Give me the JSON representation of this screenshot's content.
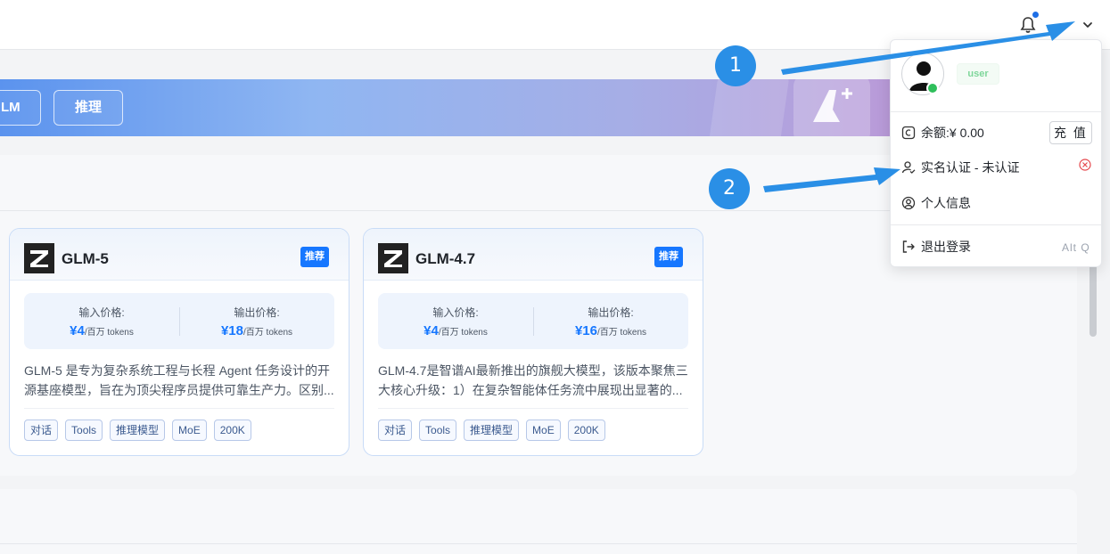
{
  "topbar": {
    "icons": [
      "bell-icon",
      "chevron-down-icon"
    ]
  },
  "banner": {
    "buttons": [
      "LM",
      "推理"
    ]
  },
  "models": [
    {
      "name": "GLM-5",
      "badge": "推荐",
      "input_label": "输入价格:",
      "input_price": "¥4",
      "output_label": "输出价格:",
      "output_price": "¥18",
      "unit": "/百万 tokens",
      "desc_line1": "GLM-5 是专为复杂系统工程与长程 Agent 任务设计的开",
      "desc_line2": "源基座模型，旨在为顶尖程序员提供可靠生产力。区别...",
      "tags": [
        "对话",
        "Tools",
        "推理模型",
        "MoE",
        "200K"
      ]
    },
    {
      "name": "GLM-4.7",
      "badge": "推荐",
      "input_label": "输入价格:",
      "input_price": "¥4",
      "output_label": "输出价格:",
      "output_price": "¥16",
      "unit": "/百万 tokens",
      "desc_line1": "GLM-4.7是智谱AI最新推出的旗舰大模型，该版本聚焦三",
      "desc_line2": "大核心升级：1）在复杂智能体任务流中展现出显著的...",
      "tags": [
        "对话",
        "Tools",
        "推理模型",
        "MoE",
        "200K"
      ]
    }
  ],
  "user_menu": {
    "role": "user",
    "balance": "余额:¥ 0.00",
    "recharge": "充 值",
    "verify": "实名认证 - 未认证",
    "profile": "个人信息",
    "logout": "退出登录",
    "logout_shortcut": "Alt Q",
    "status_color": "#2fbf5b"
  },
  "annotations": {
    "step1": "1",
    "step2": "2",
    "color": "#2a8fe6"
  }
}
